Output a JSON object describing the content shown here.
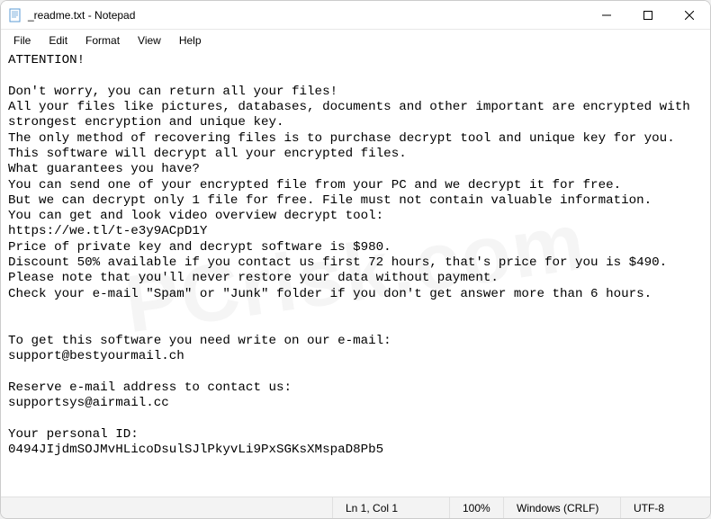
{
  "titlebar": {
    "title": "_readme.txt - Notepad"
  },
  "menu": {
    "file": "File",
    "edit": "Edit",
    "format": "Format",
    "view": "View",
    "help": "Help"
  },
  "content": {
    "text": "ATTENTION!\n\nDon't worry, you can return all your files!\nAll your files like pictures, databases, documents and other important are encrypted with strongest encryption and unique key.\nThe only method of recovering files is to purchase decrypt tool and unique key for you.\nThis software will decrypt all your encrypted files.\nWhat guarantees you have?\nYou can send one of your encrypted file from your PC and we decrypt it for free.\nBut we can decrypt only 1 file for free. File must not contain valuable information.\nYou can get and look video overview decrypt tool:\nhttps://we.tl/t-e3y9ACpD1Y\nPrice of private key and decrypt software is $980.\nDiscount 50% available if you contact us first 72 hours, that's price for you is $490.\nPlease note that you'll never restore your data without payment.\nCheck your e-mail \"Spam\" or \"Junk\" folder if you don't get answer more than 6 hours.\n\n\nTo get this software you need write on our e-mail:\nsupport@bestyourmail.ch\n\nReserve e-mail address to contact us:\nsupportsys@airmail.cc\n\nYour personal ID:\n0494JIjdmSOJMvHLicoDsulSJlPkyvLi9PxSGKsXMspaD8Pb5"
  },
  "statusbar": {
    "position": "Ln 1, Col 1",
    "zoom": "100%",
    "lineending": "Windows (CRLF)",
    "encoding": "UTF-8"
  },
  "watermark": "PCrisk.com"
}
